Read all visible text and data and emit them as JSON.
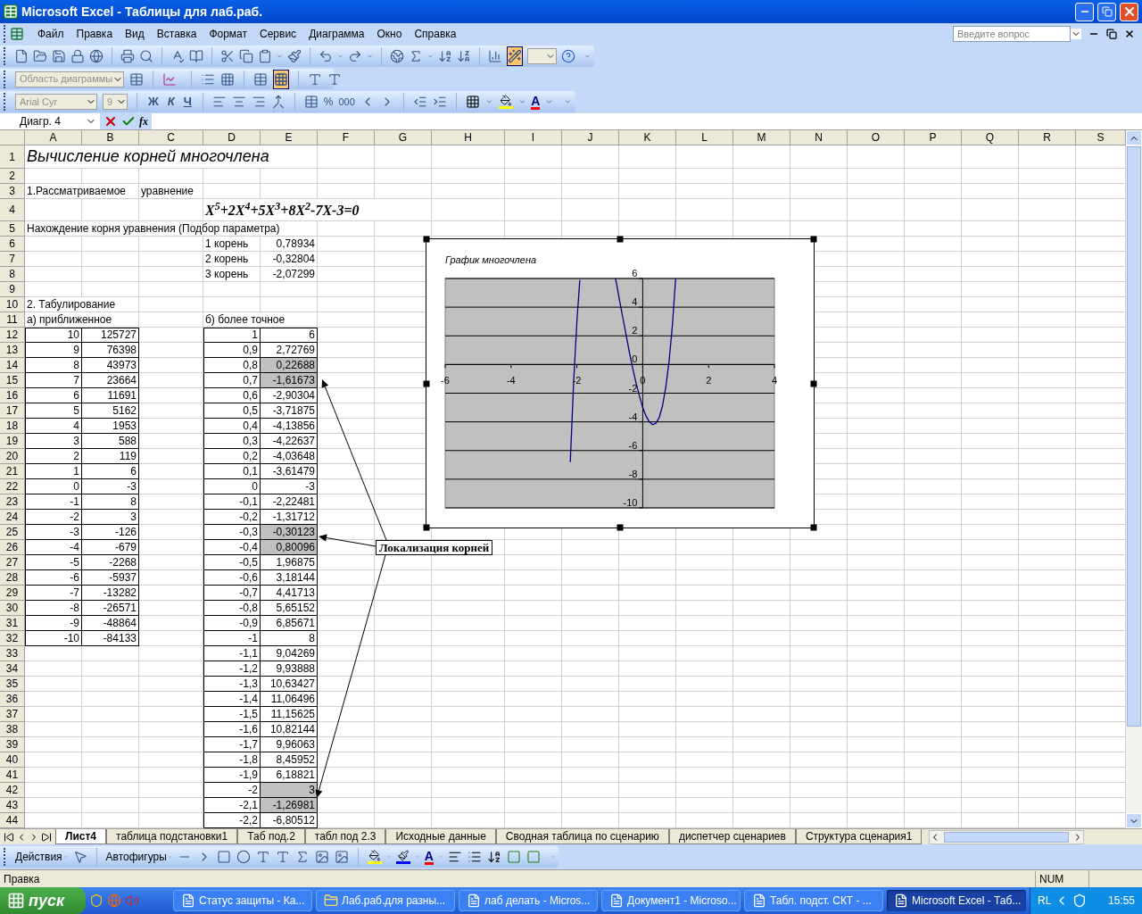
{
  "window": {
    "title": "Microsoft Excel - Таблицы для лаб.раб."
  },
  "menu": [
    {
      "label": "Файл"
    },
    {
      "label": "Правка"
    },
    {
      "label": "Вид"
    },
    {
      "label": "Вставка"
    },
    {
      "label": "Формат"
    },
    {
      "label": "Сервис"
    },
    {
      "label": "Диаграмма"
    },
    {
      "label": "Окно"
    },
    {
      "label": "Справка"
    }
  ],
  "help_box": {
    "placeholder": "Введите вопрос"
  },
  "standard_toolbar": {
    "chart_wizard_pressed": true
  },
  "chart_toolbar": {
    "object_field": "Область диаграммы",
    "by_columns_pressed": true
  },
  "format_toolbar": {
    "font": "Arial Cyr",
    "size": "9",
    "bold": "Ж",
    "italic": "К",
    "underline": "Ч",
    "percent": "%",
    "thousands": "000",
    "font_color": "A"
  },
  "formula_bar": {
    "name_box": "Диагр. 4",
    "function_button": "fx"
  },
  "columns": [
    "A",
    "B",
    "C",
    "D",
    "E",
    "F",
    "G",
    "H",
    "I",
    "J",
    "K",
    "L",
    "M",
    "N",
    "O",
    "P",
    "Q",
    "R",
    "S"
  ],
  "rows": [
    {
      "number": "1",
      "kind": "title",
      "A": "Вычисление корней многочлена"
    },
    {
      "number": "2",
      "kind": "text"
    },
    {
      "number": "3",
      "kind": "text",
      "A": "1.Рассматриваемое",
      "C": "уравнение"
    },
    {
      "number": "4",
      "kind": "formula",
      "D": "X$^{5}$+2X$^{4}$+5X$^{3}$+8X$^{2}$-7X-3=0"
    },
    {
      "number": "5",
      "kind": "text",
      "A": "Нахождение корня уравнения (Подбор параметра)"
    },
    {
      "number": "6",
      "kind": "result",
      "D": "1 корень",
      "E": "0,78934"
    },
    {
      "number": "7",
      "kind": "result",
      "D": "2 корень",
      "E": "-0,32804"
    },
    {
      "number": "8",
      "kind": "result",
      "D": "3 корень",
      "E": "-2,07299"
    },
    {
      "number": "9",
      "kind": "text"
    },
    {
      "number": "10",
      "kind": "text",
      "A": "2. Табулирование"
    },
    {
      "number": "11",
      "kind": "text",
      "A": "а) приближенное",
      "D": "б) более точное"
    },
    {
      "number": "12",
      "kind": "data",
      "A": "10",
      "B": "125727",
      "D": "1",
      "E": "6",
      "highlighted": false
    },
    {
      "number": "13",
      "kind": "data",
      "A": "9",
      "B": "76398",
      "D": "0,9",
      "E": "2,72769",
      "highlighted": false
    },
    {
      "number": "14",
      "kind": "data",
      "A": "8",
      "B": "43973",
      "D": "0,8",
      "E": "0,22688",
      "highlighted": true
    },
    {
      "number": "15",
      "kind": "data",
      "A": "7",
      "B": "23664",
      "D": "0,7",
      "E": "-1,61673",
      "highlighted": true
    },
    {
      "number": "16",
      "kind": "data",
      "A": "6",
      "B": "11691",
      "D": "0,6",
      "E": "-2,90304",
      "highlighted": false
    },
    {
      "number": "17",
      "kind": "data",
      "A": "5",
      "B": "5162",
      "D": "0,5",
      "E": "-3,71875",
      "highlighted": false
    },
    {
      "number": "18",
      "kind": "data",
      "A": "4",
      "B": "1953",
      "D": "0,4",
      "E": "-4,13856",
      "highlighted": false
    },
    {
      "number": "19",
      "kind": "data",
      "A": "3",
      "B": "588",
      "D": "0,3",
      "E": "-4,22637",
      "highlighted": false
    },
    {
      "number": "20",
      "kind": "data",
      "A": "2",
      "B": "119",
      "D": "0,2",
      "E": "-4,03648",
      "highlighted": false
    },
    {
      "number": "21",
      "kind": "data",
      "A": "1",
      "B": "6",
      "D": "0,1",
      "E": "-3,61479",
      "highlighted": false
    },
    {
      "number": "22",
      "kind": "data",
      "A": "0",
      "B": "-3",
      "D": "0",
      "E": "-3",
      "highlighted": false
    },
    {
      "number": "23",
      "kind": "data",
      "A": "-1",
      "B": "8",
      "D": "-0,1",
      "E": "-2,22481",
      "highlighted": false
    },
    {
      "number": "24",
      "kind": "data",
      "A": "-2",
      "B": "3",
      "D": "-0,2",
      "E": "-1,31712",
      "highlighted": false
    },
    {
      "number": "25",
      "kind": "data",
      "A": "-3",
      "B": "-126",
      "D": "-0,3",
      "E": "-0,30123",
      "highlighted": true
    },
    {
      "number": "26",
      "kind": "data",
      "A": "-4",
      "B": "-679",
      "D": "-0,4",
      "E": "0,80096",
      "highlighted": true
    },
    {
      "number": "27",
      "kind": "data",
      "A": "-5",
      "B": "-2268",
      "D": "-0,5",
      "E": "1,96875",
      "highlighted": false
    },
    {
      "number": "28",
      "kind": "data",
      "A": "-6",
      "B": "-5937",
      "D": "-0,6",
      "E": "3,18144",
      "highlighted": false
    },
    {
      "number": "29",
      "kind": "data",
      "A": "-7",
      "B": "-13282",
      "D": "-0,7",
      "E": "4,41713",
      "highlighted": false
    },
    {
      "number": "30",
      "kind": "data",
      "A": "-8",
      "B": "-26571",
      "D": "-0,8",
      "E": "5,65152",
      "highlighted": false
    },
    {
      "number": "31",
      "kind": "data",
      "A": "-9",
      "B": "-48864",
      "D": "-0,9",
      "E": "6,85671",
      "highlighted": false
    },
    {
      "number": "32",
      "kind": "data",
      "A": "-10",
      "B": "-84133",
      "D": "-1",
      "E": "8",
      "highlighted": false
    },
    {
      "number": "33",
      "kind": "data",
      "D": "-1,1",
      "E": "9,04269",
      "highlighted": false
    },
    {
      "number": "34",
      "kind": "data",
      "D": "-1,2",
      "E": "9,93888",
      "highlighted": false
    },
    {
      "number": "35",
      "kind": "data",
      "D": "-1,3",
      "E": "10,63427",
      "highlighted": false
    },
    {
      "number": "36",
      "kind": "data",
      "D": "-1,4",
      "E": "11,06496",
      "highlighted": false
    },
    {
      "number": "37",
      "kind": "data",
      "D": "-1,5",
      "E": "11,15625",
      "highlighted": false
    },
    {
      "number": "38",
      "kind": "data",
      "D": "-1,6",
      "E": "10,82144",
      "highlighted": false
    },
    {
      "number": "39",
      "kind": "data",
      "D": "-1,7",
      "E": "9,96063",
      "highlighted": false
    },
    {
      "number": "40",
      "kind": "data",
      "D": "-1,8",
      "E": "8,45952",
      "highlighted": false
    },
    {
      "number": "41",
      "kind": "data",
      "D": "-1,9",
      "E": "6,18821",
      "highlighted": false
    },
    {
      "number": "42",
      "kind": "data",
      "D": "-2",
      "E": "3",
      "highlighted": true
    },
    {
      "number": "43",
      "kind": "data",
      "D": "-2,1",
      "E": "-1,26981",
      "highlighted": true
    },
    {
      "number": "44",
      "kind": "data",
      "D": "-2,2",
      "E": "-6,80512",
      "highlighted": false
    }
  ],
  "chart": {
    "chart_data": {
      "type": "line",
      "title": "График многочлена",
      "x": [
        1,
        0.9,
        0.8,
        0.7,
        0.6,
        0.5,
        0.4,
        0.3,
        0.2,
        0.1,
        0,
        -0.1,
        -0.2,
        -0.3,
        -0.4,
        -0.5,
        -0.6,
        -0.7,
        -0.8,
        -0.83,
        -0.9,
        -1,
        -1.1,
        -1.2,
        -1.3,
        -1.4,
        -1.5,
        -1.6,
        -1.7,
        -1.8,
        -1.9,
        -1.91,
        -2,
        -2.1,
        -2.2
      ],
      "series": [
        {
          "color": "#000080",
          "values": [
            6,
            2.7,
            0.2,
            -1.6,
            -2.9,
            -3.7,
            -4.1,
            -4.2,
            -4,
            -3.6,
            -3,
            -2.2,
            -1.3,
            -0.3,
            0.8,
            2,
            3.2,
            4.4,
            5.7,
            6,
            null,
            null,
            null,
            null,
            null,
            null,
            null,
            null,
            null,
            null,
            null,
            5.9,
            3,
            -1.3,
            -6.8
          ]
        }
      ],
      "grid": true,
      "xlim": [
        -6,
        4
      ],
      "ylim": [
        -10,
        6
      ],
      "xticks": [
        -6,
        -4,
        -2,
        0,
        2,
        4
      ],
      "yticks": [
        6,
        4,
        2,
        0,
        -2,
        -4,
        -6,
        -8,
        -10
      ]
    }
  },
  "callout": {
    "text": "Локализация корней"
  },
  "sheet_tabs": [
    {
      "label": "Лист4",
      "selected": true
    },
    {
      "label": "таблица подстановки1",
      "selected": false
    },
    {
      "label": "Таб под.2",
      "selected": false
    },
    {
      "label": "табл под 2.3",
      "selected": false
    },
    {
      "label": "Исходные данные",
      "selected": false
    },
    {
      "label": "Сводная таблица по сценарию",
      "selected": false
    },
    {
      "label": "диспетчер сценариев",
      "selected": false
    },
    {
      "label": "Структура сценария1",
      "selected": false
    }
  ],
  "drawing_toolbar": {
    "actions": "Действия",
    "autoshapes": "Автофигуры",
    "font_color": "A"
  },
  "status_bar": {
    "mode": "Правка",
    "num": "NUM"
  },
  "taskbar": {
    "start": "пуск",
    "tasks": [
      {
        "label": "Статус защиты - Ка...",
        "selected": false
      },
      {
        "label": "Лаб.раб.для разны...",
        "selected": false
      },
      {
        "label": "лаб делать - Micros...",
        "selected": false
      },
      {
        "label": "Документ1 - Microso...",
        "selected": false
      },
      {
        "label": "Табл. подст. СКТ - ...",
        "selected": false
      },
      {
        "label": "Microsoft Excel - Таб...",
        "selected": true
      }
    ],
    "language": "RL",
    "clock": "15:55"
  }
}
